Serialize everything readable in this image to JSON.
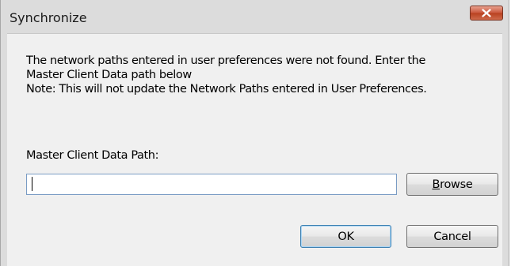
{
  "window": {
    "title": "Synchronize"
  },
  "message": {
    "line1": "The network paths entered in user preferences were not found.  Enter the",
    "line2": "Master Client Data path below",
    "line3": "Note:  This will not update the Network Paths entered in User Preferences."
  },
  "path_field": {
    "label": "Master Client Data Path:",
    "value": "",
    "placeholder": ""
  },
  "buttons": {
    "browse_rest": "rowse",
    "browse_mnemonic": "B",
    "ok": "OK",
    "cancel": "Cancel"
  },
  "icons": {
    "close": "close-icon"
  },
  "colors": {
    "close_button": "#c9563a",
    "input_border": "#7a9cc4",
    "default_button_border": "#3c7fb1"
  }
}
